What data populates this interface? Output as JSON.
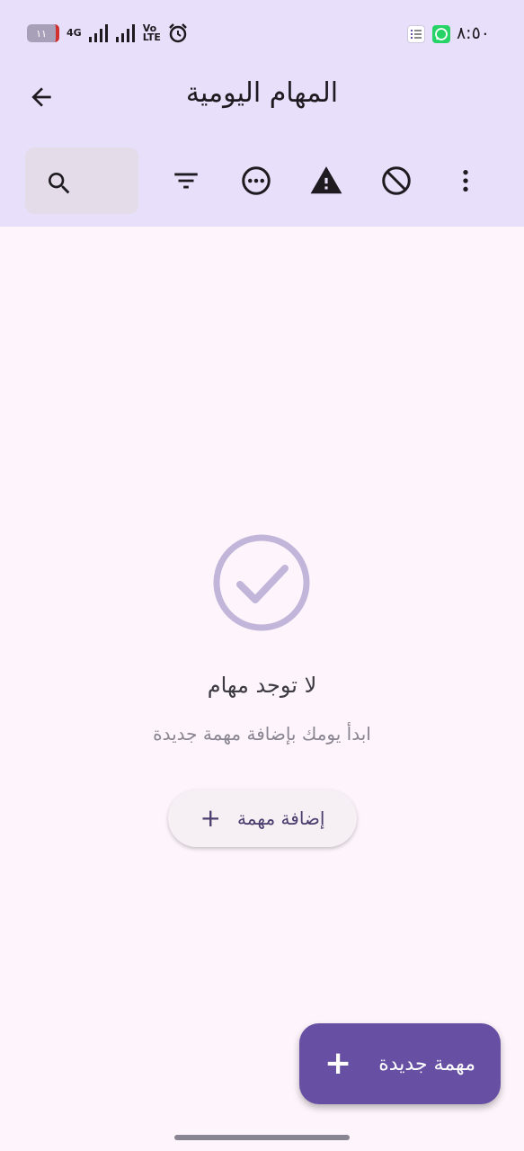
{
  "status_bar": {
    "time": "٨:٥٠",
    "battery": "١١",
    "network": "4G",
    "volte_top": "Vo",
    "volte_bottom": "LTE",
    "icons": [
      "battery-icon",
      "signal-icon",
      "alarm-icon",
      "tasks-notification-icon",
      "whatsapp-icon"
    ]
  },
  "header": {
    "title": "المهام اليومية",
    "back_icon": "arrow-back-icon"
  },
  "toolbar": {
    "icons": [
      "search-icon",
      "filter-icon",
      "more-horiz-icon",
      "warning-icon",
      "block-icon",
      "more-vert-icon"
    ]
  },
  "empty_state": {
    "icon": "check-circle-icon",
    "title": "لا توجد مهام",
    "subtitle": "ابدأ يومك بإضافة مهمة جديدة",
    "add_button_label": "إضافة مهمة",
    "add_button_icon": "plus-icon"
  },
  "fab": {
    "label": "مهمة جديدة",
    "icon": "plus-icon"
  },
  "colors": {
    "appbar": "#e8dffa",
    "background": "#fdf5fb",
    "primary": "#6750a4",
    "check_icon": "#c2b5da"
  }
}
